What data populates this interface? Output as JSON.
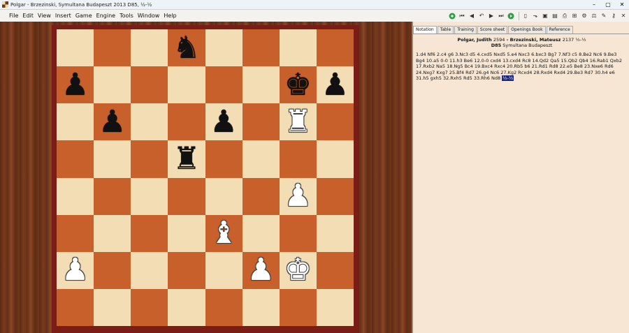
{
  "window": {
    "title": "Polgar - Brzezinski, Symultana Budapeszt 2013  D85, ½-½"
  },
  "menu": [
    "File",
    "Edit",
    "View",
    "Insert",
    "Game",
    "Engine",
    "Tools",
    "Window",
    "Help"
  ],
  "toolbar_icons": [
    "green-circle-icon",
    "first-move-icon",
    "prev-move-icon",
    "take-back-icon",
    "next-move-icon",
    "last-move-icon",
    "green-plus-icon",
    "new-game-icon",
    "open-icon",
    "save-icon",
    "save-as-icon",
    "print-icon",
    "board-setup-icon",
    "engine-icon",
    "analysis-icon",
    "pen-icon",
    "key-icon",
    "close-doc-icon"
  ],
  "tabs": [
    {
      "label": "Notation",
      "active": true
    },
    {
      "label": "Table",
      "active": false
    },
    {
      "label": "Training",
      "active": false
    },
    {
      "label": "Score sheet",
      "active": false
    },
    {
      "label": "Openings Book",
      "active": false
    },
    {
      "label": "Reference",
      "active": false
    }
  ],
  "game": {
    "white": "Polgar, Judith",
    "white_elo": "2594",
    "separator": " - ",
    "black": "Brzezinski, Mateusz",
    "black_elo": "2137",
    "result": "½-½",
    "eco": "D85",
    "event": "Symultana Budapeszt",
    "moves": "1.d4 Nf6 2.c4 g6 3.Nc3 d5 4.cxd5 Nxd5 5.e4 Nxc3 6.bxc3 Bg7 7.Nf3 c5 8.Be2 Nc6 9.Be3 Bg4 10.a5 0-0 11.h3 Be6 12.0-0 cxd4 13.cxd4 Rc8 14.Qd2 Qa5 15.Qb2 Qb4 16.Rab1 Qxb2 17.Rxb2 Na5 18.Ng5 Bc4 19.Bxc4 Rxc4 20.Rb5 b6 21.Rd1 Rd8 22.e5 Be8 23.Nxe6 Rd6 24.Nxg7 Kxg7 25.Bf4 Rd7 26.g4 Nc6 27.Kg2 Rcxd4 28.Rxd4 Rxd4 29.Be3 Rd7 30.h4 e6 31.h5 gxh5 32.Rxh5 Rd5 33.Rh6 Nd8",
    "final_result": "½-½"
  },
  "position": [
    [
      "",
      "",
      "",
      "n",
      "",
      "",
      "",
      ""
    ],
    [
      "p",
      "",
      "",
      "",
      "",
      "",
      "k",
      "p"
    ],
    [
      "",
      "p",
      "",
      "",
      "p",
      "",
      "R",
      ""
    ],
    [
      "",
      "",
      "",
      "r",
      "",
      "",
      "",
      ""
    ],
    [
      "",
      "",
      "",
      "",
      "",
      "",
      "P",
      ""
    ],
    [
      "",
      "",
      "",
      "",
      "B",
      "",
      "",
      ""
    ],
    [
      "P",
      "",
      "",
      "",
      "",
      "P",
      "K",
      ""
    ],
    [
      "",
      "",
      "",
      "",
      "",
      "",
      "",
      ""
    ]
  ]
}
